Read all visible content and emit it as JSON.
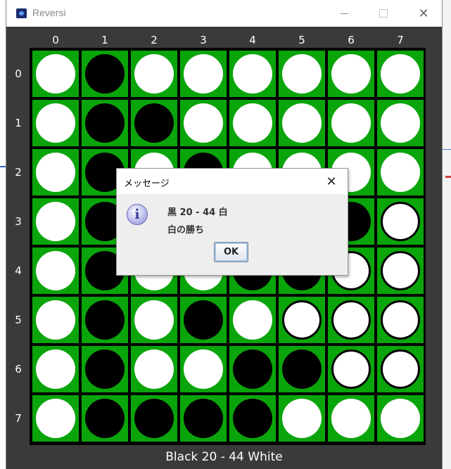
{
  "window": {
    "title": "Reversi",
    "minimize": "min",
    "maximize": "max",
    "close": "✕"
  },
  "board": {
    "column_labels": [
      "0",
      "1",
      "2",
      "3",
      "4",
      "5",
      "6",
      "7"
    ],
    "row_labels": [
      "0",
      "1",
      "2",
      "3",
      "4",
      "5",
      "6",
      "7"
    ],
    "cells": [
      [
        "W",
        "B",
        "W",
        "W",
        "W",
        "W",
        "W",
        "W"
      ],
      [
        "W",
        "B",
        "B",
        "W",
        "W",
        "W",
        "W",
        "W"
      ],
      [
        "W",
        "B",
        "W",
        "B",
        "W",
        "W",
        "W",
        "W"
      ],
      [
        "W",
        "B",
        "W",
        "W",
        "W",
        "W",
        "B",
        "W"
      ],
      [
        "W",
        "B",
        "W",
        "W",
        "B",
        "B",
        "W",
        "W"
      ],
      [
        "W",
        "B",
        "W",
        "B",
        "W",
        "W",
        "W",
        "W"
      ],
      [
        "W",
        "B",
        "W",
        "W",
        "B",
        "B",
        "W",
        "W"
      ],
      [
        "W",
        "B",
        "B",
        "B",
        "B",
        "W",
        "W",
        "W"
      ]
    ],
    "ringed": [
      [
        3,
        7
      ],
      [
        4,
        6
      ],
      [
        4,
        7
      ],
      [
        5,
        5
      ],
      [
        5,
        6
      ],
      [
        5,
        7
      ],
      [
        6,
        6
      ],
      [
        6,
        7
      ]
    ],
    "colors": {
      "board_green": "#0aa50a",
      "grid": "#000000",
      "white_disc": "#ffffff",
      "black_disc": "#000000"
    }
  },
  "status": {
    "text": "Black 20 - 44 White"
  },
  "dialog": {
    "title": "メッセージ",
    "close_label": "✕",
    "icon": "info-icon",
    "line1": "黒 20 - 44 白",
    "line2": "白の勝ち",
    "ok_label": "OK"
  }
}
